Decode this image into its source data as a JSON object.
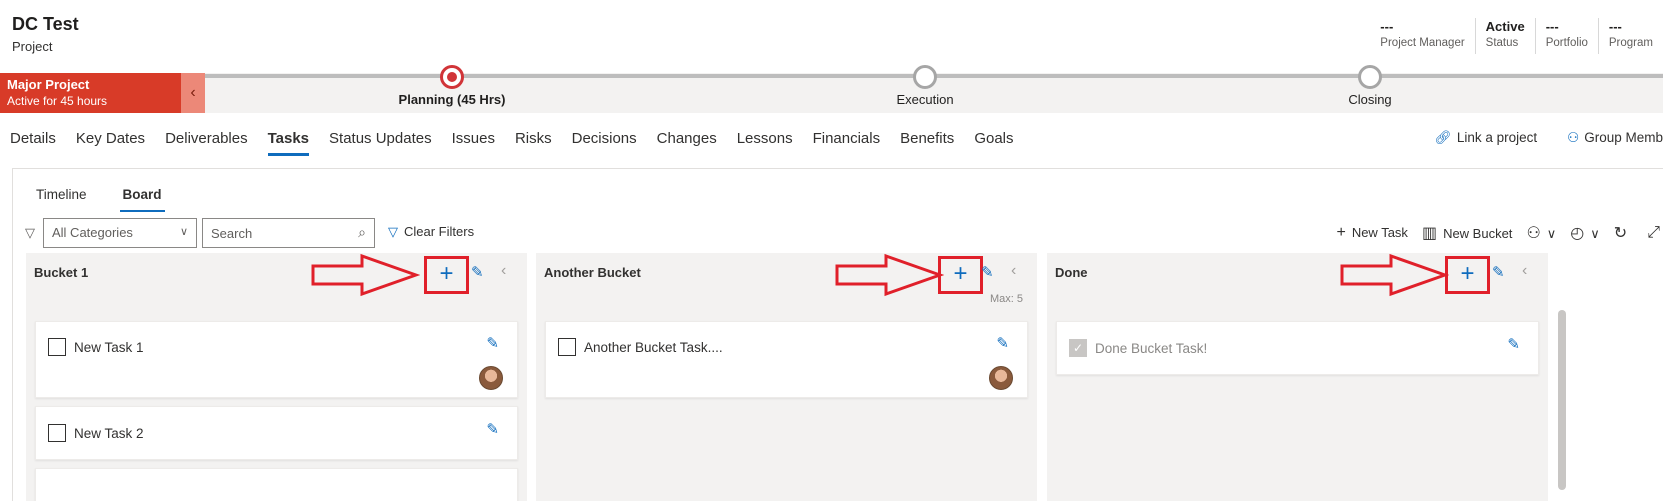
{
  "header": {
    "title": "DC Test",
    "subtitle": "Project",
    "fields": [
      {
        "value": "---",
        "label": "Project Manager"
      },
      {
        "value": "Active",
        "label": "Status"
      },
      {
        "value": "---",
        "label": "Portfolio"
      },
      {
        "value": "---",
        "label": "Program"
      }
    ]
  },
  "stagebar": {
    "active_name": "Major Project",
    "active_time": "Active for 45 hours",
    "collapse_icon": "chevron-left-icon",
    "stages": [
      {
        "label": "Planning  (45 Hrs)",
        "current": true
      },
      {
        "label": "Execution",
        "current": false
      },
      {
        "label": "Closing",
        "current": false
      }
    ]
  },
  "tabs": [
    "Details",
    "Key Dates",
    "Deliverables",
    "Tasks",
    "Status Updates",
    "Issues",
    "Risks",
    "Decisions",
    "Changes",
    "Lessons",
    "Financials",
    "Benefits",
    "Goals"
  ],
  "active_tab": "Tasks",
  "tab_actions": {
    "link_project": "Link a project",
    "group_members": "Group Memb"
  },
  "subtabs": [
    "Timeline",
    "Board"
  ],
  "filters": {
    "category_value": "All Categories",
    "search_placeholder": "Search",
    "clear_filters": "Clear Filters"
  },
  "actions": {
    "new_task": "New Task",
    "new_bucket": "New Bucket"
  },
  "buckets": [
    {
      "title": "Bucket 1",
      "max": "",
      "tasks": [
        {
          "title": "New Task 1",
          "done": false,
          "avatar": true
        },
        {
          "title": "New Task 2",
          "done": false,
          "avatar": false
        }
      ]
    },
    {
      "title": "Another Bucket",
      "max": "Max: 5",
      "tasks": [
        {
          "title": "Another Bucket Task....",
          "done": false,
          "avatar": true
        }
      ]
    },
    {
      "title": "Done",
      "max": "",
      "tasks": [
        {
          "title": "Done Bucket Task!",
          "done": true,
          "avatar": false
        }
      ]
    }
  ],
  "colors": {
    "accent": "#0f6cbd",
    "stage_active": "#d83b28",
    "annotation": "#e0202a"
  }
}
